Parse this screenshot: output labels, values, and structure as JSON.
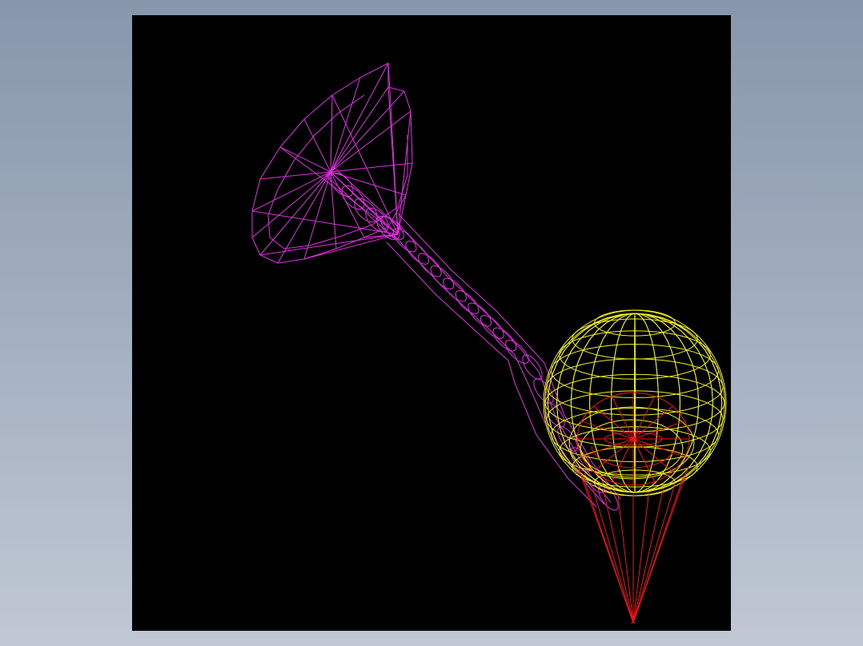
{
  "scene": {
    "background": "#000000",
    "page_background": [
      "#8796ab",
      "#c0c8d4"
    ],
    "parts": [
      {
        "name": "funnel",
        "color": "#e62ce6"
      },
      {
        "name": "tube",
        "color": "#e62ce6"
      },
      {
        "name": "sphere",
        "color": "#f0f01e"
      },
      {
        "name": "cone",
        "color": "#f01414"
      }
    ]
  }
}
